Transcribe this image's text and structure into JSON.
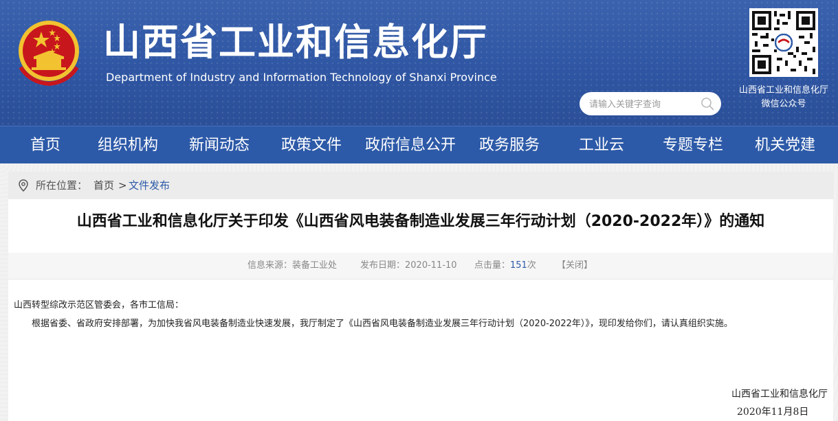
{
  "header": {
    "title": "山西省工业和信息化厅",
    "subtitle": "Department of Industry and Information Technology of Shanxi Province",
    "search_placeholder": "请输入关键字查询",
    "qr_caption_line1": "山西省工业和信息化厅",
    "qr_caption_line2": "微信公众号"
  },
  "nav": {
    "items": [
      "首页",
      "组织机构",
      "新闻动态",
      "政策文件",
      "政府信息公开",
      "政务服务",
      "工业云",
      "专题专栏",
      "机关党建"
    ]
  },
  "breadcrumb": {
    "label": "所在位置：",
    "home": "首页",
    "separator": ">",
    "current": "文件发布"
  },
  "article": {
    "title": "山西省工业和信息化厅关于印发《山西省风电装备制造业发展三年行动计划（2020-2022年）》的通知",
    "meta": {
      "source_label": "信息来源：",
      "source_value": "装备工业处",
      "date_label": "发布日期：",
      "date_value": "2020-11-10",
      "views_label": "点击量：",
      "views_value": "151",
      "views_unit": "次",
      "close_label": "【关闭】"
    },
    "salutation": "山西转型综改示范区管委会，各市工信局：",
    "body": "根据省委、省政府安排部署，为加快我省风电装备制造业快速发展，我厅制定了《山西省风电装备制造业发展三年行动计划（2020-2022年）》，现印发给你们，请认真组织实施。",
    "signature": "山西省工业和信息化厅",
    "sign_date": "2020年11月8日"
  },
  "colors": {
    "header_blue": "#2f56a3",
    "nav_blue": "#2d5aa8",
    "emblem_red": "#c8161d",
    "emblem_gold": "#f2c230"
  }
}
